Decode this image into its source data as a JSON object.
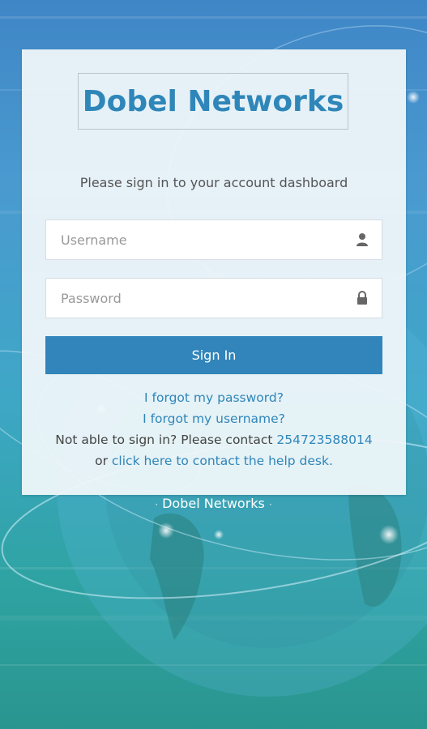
{
  "brand": {
    "logo_text": "Dobel Networks"
  },
  "login": {
    "subtitle": "Please sign in to your account dashboard",
    "username_placeholder": "Username",
    "password_placeholder": "Password",
    "username_icon": "user-icon",
    "password_icon": "lock-icon",
    "signin_label": "Sign In"
  },
  "help": {
    "forgot_password": "I forgot my password?",
    "forgot_username": "I forgot my username?",
    "contact_prefix": "Not able to sign in? Please contact",
    "contact_phone": "254723588014",
    "or_text": "or",
    "help_desk_link": "click here to contact the help desk."
  },
  "footer": {
    "brand": "Dobel Networks",
    "separator": "·"
  },
  "colors": {
    "accent": "#3285ba",
    "link": "#2f86b9",
    "logo": "#2f86b9"
  }
}
